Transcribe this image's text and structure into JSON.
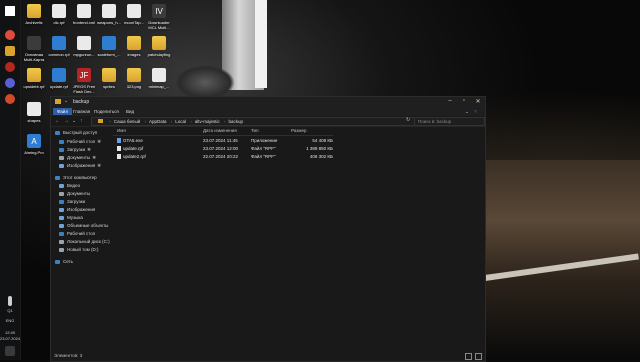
{
  "taskbar": {
    "time": "12:49",
    "date": "23.07.2024",
    "lang": "ENG",
    "notif": "Q1"
  },
  "desktop_icons": [
    {
      "label": "Archivefix",
      "icon": "folder"
    },
    {
      "label": "dlc.rpf",
      "icon": "doc"
    },
    {
      "label": "frontend.xml",
      "icon": "doc"
    },
    {
      "label": "weapons_h...",
      "icon": "doc"
    },
    {
      "label": "moonTap...",
      "icon": "doc"
    },
    {
      "label": "Downloader MCL Multi...",
      "icon": "dark"
    },
    {
      "label": "Основная Multi-Карта",
      "icon": "dark"
    },
    {
      "label": "common.rpf",
      "icon": "blue"
    },
    {
      "label": "mpgunrun...",
      "icon": "doc"
    },
    {
      "label": "scaleform_...",
      "icon": "blue"
    },
    {
      "label": "images",
      "icon": "folder"
    },
    {
      "label": "patchdayfing",
      "icon": "folder"
    },
    {
      "label": "upsidebt.rpf",
      "icon": "folder"
    },
    {
      "label": "update.rpf",
      "icon": "blue"
    },
    {
      "label": "JPEGS Free Flash Dec...",
      "icon": "red"
    },
    {
      "label": "sprites",
      "icon": "folder"
    },
    {
      "label": "323.png",
      "icon": "folder"
    },
    {
      "label": "minimap_...",
      "icon": "doc"
    },
    {
      "label": "shapes",
      "icon": "doc"
    },
    {
      "label": "Aiming.Pro",
      "icon": "blue"
    }
  ],
  "window": {
    "title": "backup",
    "ribbon_tabs": [
      "Файл",
      "Главная",
      "Поделиться",
      "Вид"
    ],
    "path": [
      "Саша белый",
      "AppData",
      "Local",
      "altv-majestic",
      "backup"
    ],
    "search_placeholder": "Поиск в: backup",
    "nav_items": [
      {
        "label": "Быстрый доступ",
        "icon": "star-icon",
        "color": "#3b82c4"
      },
      {
        "label": "Рабочий стол",
        "icon": "desktop-icon",
        "color": "#3b82c4"
      },
      {
        "label": "Загрузки",
        "icon": "download-icon",
        "color": "#3b82c4"
      },
      {
        "label": "Документы",
        "icon": "documents-icon",
        "color": "#9aa4b0"
      },
      {
        "label": "Изображения",
        "icon": "pictures-icon",
        "color": "#6fa2d6"
      },
      {
        "label": "Этот компьютер",
        "icon": "pc-icon",
        "color": "#3b82c4"
      },
      {
        "label": "Видео",
        "icon": "video-icon",
        "color": "#6fa2d6"
      },
      {
        "label": "Документы",
        "icon": "documents-icon",
        "color": "#9aa4b0"
      },
      {
        "label": "Загрузки",
        "icon": "download-icon",
        "color": "#3b82c4"
      },
      {
        "label": "Изображения",
        "icon": "pictures-icon",
        "color": "#6fa2d6"
      },
      {
        "label": "Музыка",
        "icon": "music-icon",
        "color": "#6fa2d6"
      },
      {
        "label": "Объемные объекты",
        "icon": "3d-icon",
        "color": "#6fa2d6"
      },
      {
        "label": "Рабочий стол",
        "icon": "desktop-icon",
        "color": "#3b82c4"
      },
      {
        "label": "Локальный диск (C:)",
        "icon": "drive-icon",
        "color": "#9aa4b0"
      },
      {
        "label": "Новый том (D:)",
        "icon": "drive-icon",
        "color": "#9aa4b0"
      },
      {
        "label": "Сеть",
        "icon": "network-icon",
        "color": "#3b82c4"
      }
    ],
    "columns": [
      "Имя",
      "Дата изменения",
      "Тип",
      "Размер"
    ],
    "files": [
      {
        "name": "GTA5.exe",
        "date": "23.07.2024 11:45",
        "type": "Приложение",
        "size": "54 408 КБ",
        "icon": "exe"
      },
      {
        "name": "update.rpf",
        "date": "23.07.2024 12:00",
        "type": "Файл \"RPF\"",
        "size": "1 389 850 КБ",
        "icon": "file"
      },
      {
        "name": "update2.rpf",
        "date": "22.07.2024 20:22",
        "type": "Файл \"RPF\"",
        "size": "406 302 КБ",
        "icon": "file"
      }
    ],
    "status": "Элементов: 3"
  }
}
